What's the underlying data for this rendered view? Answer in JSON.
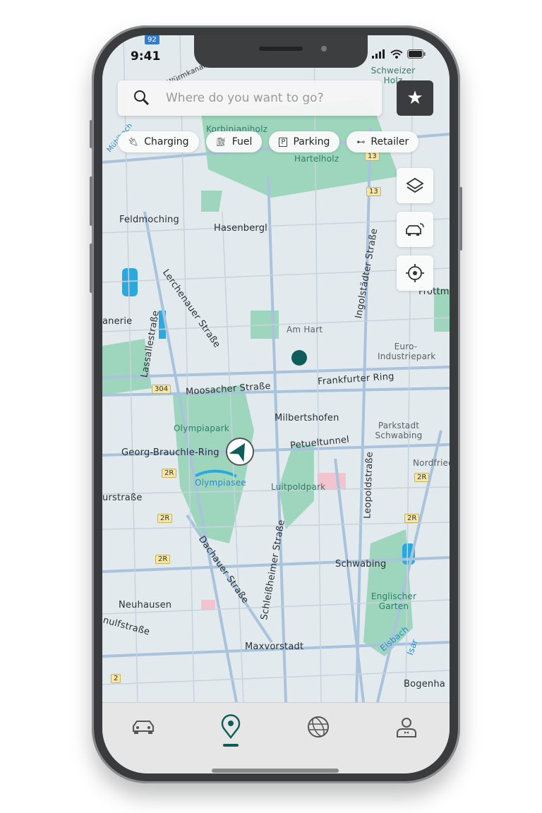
{
  "status_bar": {
    "time": "9:41"
  },
  "search": {
    "placeholder": "Where do you want to go?"
  },
  "filters": [
    {
      "label": "Charging",
      "icon": "charging-plug-icon"
    },
    {
      "label": "Fuel",
      "icon": "fuel-pump-icon"
    },
    {
      "label": "Parking",
      "icon": "parking-icon"
    },
    {
      "label": "Retailer",
      "icon": "retailer-wings-icon"
    }
  ],
  "map_controls": [
    "layers-icon",
    "car-connect-icon",
    "locate-icon"
  ],
  "map": {
    "labels": [
      "Schweizer Holz",
      "Korbinianiholz",
      "Hartelholz",
      "Feldmoching",
      "Hasenbergl",
      "Lerchenauer Straße",
      "Lassallestraße",
      "Ingolstädter Straße",
      "Am Hart",
      "Euro-Industriepark",
      "Moosacher Straße",
      "Frankfurter Ring",
      "Olympiapark",
      "Milbertshofen",
      "Parkstadt Schwabing",
      "Georg-Brauchle-Ring",
      "Petueltunnel",
      "Olympiasee",
      "Luitpoldpark",
      "Leopoldstraße",
      "Nordfried",
      "Schleißheimer Straße",
      "Dachauer Straße",
      "Schwabing",
      "Englischer Garten",
      "Neuhausen",
      "Maxvorstadt",
      "Bogenha",
      "Eisbach",
      "Isar",
      "anerie",
      "urstraße",
      "nulfstraße",
      "Frottm",
      "Mühlbach",
      "Würmkanal"
    ],
    "road_badges": [
      "92",
      "13",
      "13",
      "304",
      "2R",
      "2R",
      "2R",
      "2R",
      "2R",
      "2"
    ]
  },
  "colors": {
    "accent": "#0d5e5a",
    "park": "#8fcfb3",
    "water": "#29a9e0",
    "road": "#a9c3dd"
  },
  "bottom_nav": [
    {
      "icon": "car-icon",
      "active": false
    },
    {
      "icon": "map-pin-icon",
      "active": true
    },
    {
      "icon": "globe-icon",
      "active": false
    },
    {
      "icon": "profile-icon",
      "active": false
    }
  ]
}
